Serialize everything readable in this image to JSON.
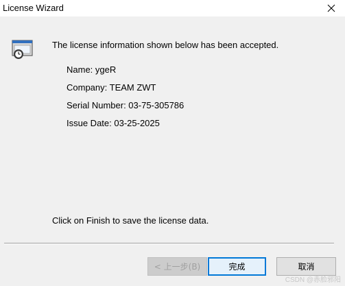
{
  "window": {
    "title": "License Wizard",
    "close_symbol": "X"
  },
  "content": {
    "message": "The license information shown below has been accepted.",
    "info": {
      "name": "Name: ygeR",
      "company": "Company: TEAM ZWT",
      "serial": "Serial Number: 03-75-305786",
      "issue_date": "Issue Date: 03-25-2025"
    },
    "footer_message": "Click on Finish to save the license data."
  },
  "buttons": {
    "back": "< 上一步(B)",
    "finish": "完成",
    "cancel": "取消"
  },
  "watermark": "CSDN @赤脸邪阳",
  "icons": {
    "app": "license-wizard-icon",
    "close": "close-icon"
  },
  "colors": {
    "background": "#f0f0f0",
    "default_button_border": "#0078d7"
  }
}
